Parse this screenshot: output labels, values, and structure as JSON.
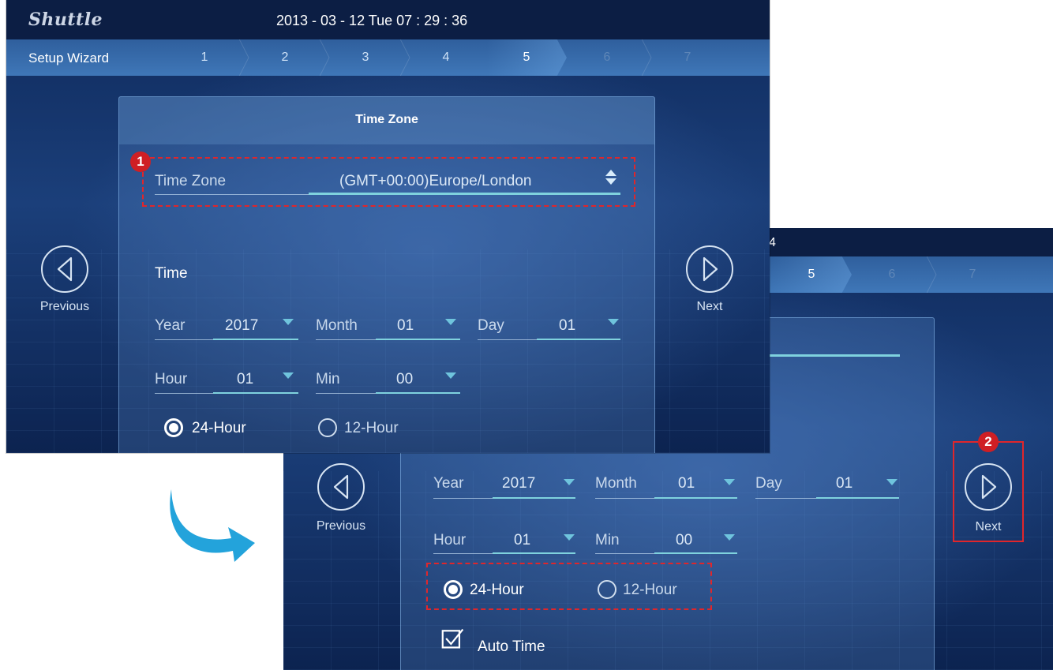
{
  "colors": {
    "annotation_red": "#e0262b",
    "accent_cyan": "#7fd2de",
    "bg_dark_blue": "#0f2a5c"
  },
  "screen_a": {
    "brand": "Shuttle",
    "clock": "2013 - 03 - 12  Tue  07 : 29 : 36",
    "wizard_title": "Setup Wizard",
    "steps": [
      "1",
      "2",
      "3",
      "4",
      "5",
      "6",
      "7"
    ],
    "panel_title": "Time Zone",
    "time_zone_label": "Time Zone",
    "time_zone_value": "(GMT+00:00)Europe/London",
    "time_label": "Time",
    "year_label": "Year",
    "year_value": "2017",
    "month_label": "Month",
    "month_value": "01",
    "day_label": "Day",
    "day_value": "01",
    "hour_label": "Hour",
    "hour_value": "01",
    "min_label": "Min",
    "min_value": "00",
    "format_24": "24-Hour",
    "format_12": "12-Hour",
    "previous": "Previous",
    "next": "Next",
    "annotation_1": "1"
  },
  "screen_b": {
    "clock_fragment": "4",
    "steps": [
      "5",
      "6",
      "7"
    ],
    "year_label": "Year",
    "year_value": "2017",
    "month_label": "Month",
    "month_value": "01",
    "day_label": "Day",
    "day_value": "01",
    "hour_label": "Hour",
    "hour_value": "01",
    "min_label": "Min",
    "min_value": "00",
    "format_24": "24-Hour",
    "format_12": "12-Hour",
    "auto_time": "Auto Time",
    "previous": "Previous",
    "next": "Next",
    "annotation_2": "2"
  },
  "icons": [
    "arrow-icon",
    "chevron-left-circle-icon",
    "chevron-right-circle-icon",
    "checkbox-checked-icon",
    "spinner-icon",
    "dropdown-triangle-icon"
  ]
}
